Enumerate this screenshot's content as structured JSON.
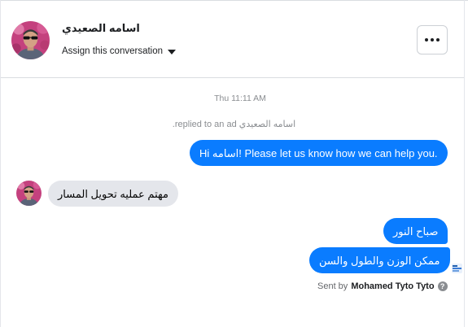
{
  "header": {
    "contact_name": "اسامه الصعيدي",
    "assign_label": "Assign this conversation",
    "assign_caret_icon": "caret-down-icon",
    "more_icon": "more-horizontal-icon"
  },
  "thread": {
    "timestamp": "Thu 11:11 AM",
    "system_message": "اسامه الصعيدي replied to an ad.",
    "messages": [
      {
        "direction": "outgoing",
        "text": "Hi اسامه! Please let us know how we can help you."
      },
      {
        "direction": "incoming",
        "text": "مهتم عمليه تحويل المسار"
      },
      {
        "direction": "outgoing",
        "text": "صباح النور"
      },
      {
        "direction": "outgoing",
        "text": "ممكن الوزن والطول والسن"
      }
    ],
    "sent_by_prefix": "Sent by",
    "sent_by_name": "Mohamed Tyto Tyto",
    "help_icon_glyph": "?"
  },
  "colors": {
    "outgoing_bubble": "#0a7cff",
    "incoming_bubble": "#e4e6eb",
    "meta_text": "#8a8d91"
  }
}
